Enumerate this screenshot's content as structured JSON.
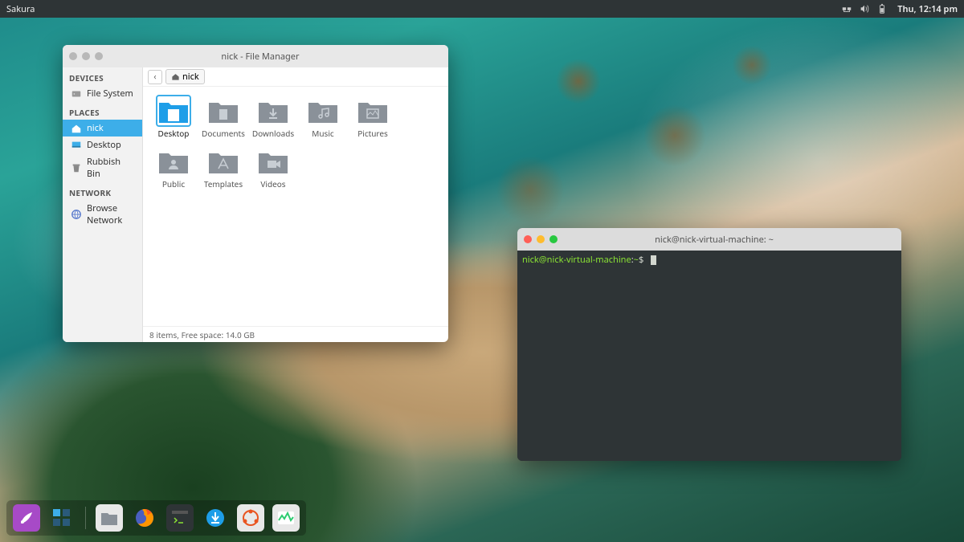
{
  "panel": {
    "app_menu": "Sakura",
    "clock": "Thu, 12:14 pm"
  },
  "file_manager": {
    "title": "nick - File Manager",
    "sidebar": {
      "devices_header": "DEVICES",
      "file_system": "File System",
      "places_header": "PLACES",
      "home": "nick",
      "desktop": "Desktop",
      "trash": "Rubbish Bin",
      "network_header": "NETWORK",
      "browse_network": "Browse Network"
    },
    "breadcrumb": "nick",
    "folders": {
      "desktop": "Desktop",
      "documents": "Documents",
      "downloads": "Downloads",
      "music": "Music",
      "pictures": "Pictures",
      "public": "Public",
      "templates": "Templates",
      "videos": "Videos"
    },
    "status": "8 items, Free space: 14.0 GB"
  },
  "terminal": {
    "title": "nick@nick-virtual-machine: ~",
    "prompt_user": "nick@nick-virtual-machine",
    "prompt_sep": ":",
    "prompt_path": "~",
    "prompt_char": "$"
  },
  "dock": {
    "items": [
      "launcher",
      "workspaces",
      "files",
      "firefox",
      "terminal",
      "downloads",
      "software",
      "monitor"
    ]
  }
}
